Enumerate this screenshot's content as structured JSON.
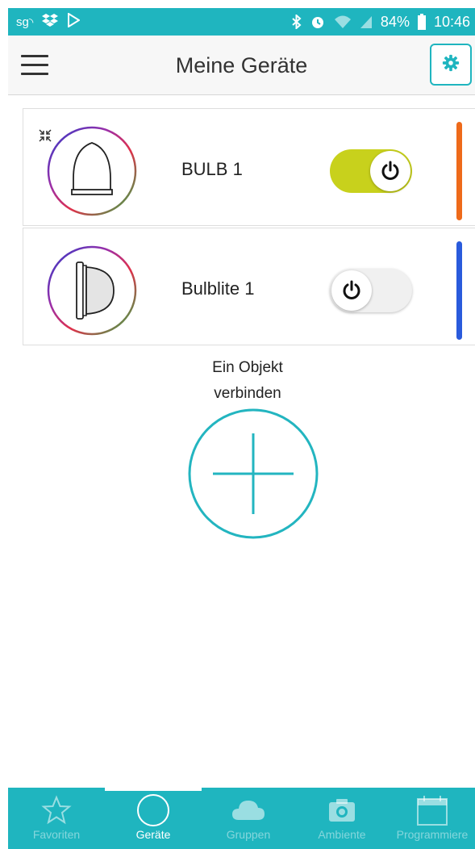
{
  "status_bar": {
    "left_label": "sg",
    "battery": "84%",
    "time": "10:46",
    "icons": [
      "signal-icon",
      "dropbox-icon",
      "play-store-icon",
      "bluetooth-icon",
      "alarm-icon",
      "wifi-icon",
      "cell-signal-icon",
      "battery-icon"
    ]
  },
  "header": {
    "title": "Meine Geräte",
    "menu_icon": "hamburger-icon",
    "settings_icon": "gear-icon"
  },
  "devices": [
    {
      "name": "BULB 1",
      "state": "on",
      "stripe_color": "#ee6a1a",
      "icon": "bulb-icon",
      "ring": "rgb-ring"
    },
    {
      "name": "Bulblite 1",
      "state": "off",
      "stripe_color": "#2a5bdc",
      "icon": "bulblite-icon",
      "ring": "rgb-ring"
    }
  ],
  "connect": {
    "line1": "Ein Objekt",
    "line2": "verbinden"
  },
  "nav": {
    "active": "Geräte",
    "items": [
      {
        "label": "Favoriten",
        "icon": "star-icon"
      },
      {
        "label": "Geräte",
        "icon": "circle-icon"
      },
      {
        "label": "Gruppen",
        "icon": "cloud-icon"
      },
      {
        "label": "Ambiente",
        "icon": "camera-icon"
      },
      {
        "label": "Programmiere",
        "icon": "calendar-icon"
      }
    ]
  },
  "colors": {
    "accent": "#1fb5bf",
    "toggle_on": "#c8d11c",
    "bulb1_stripe": "#ee6a1a",
    "bulblite_stripe": "#2a5bdc"
  }
}
